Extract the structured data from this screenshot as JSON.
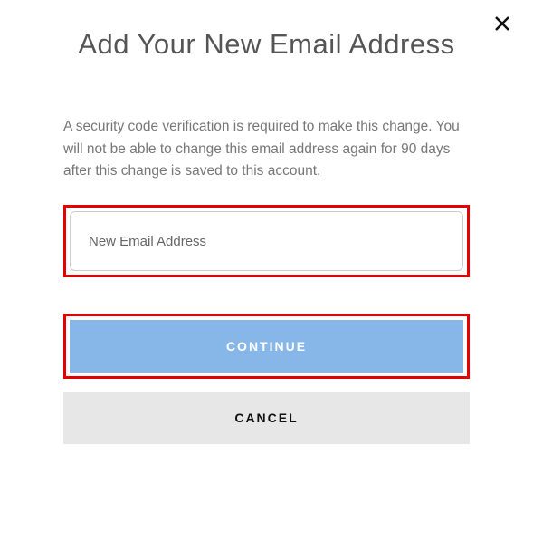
{
  "modal": {
    "title": "Add Your New Email Address",
    "description": "A security code verification is required to make this change. You will not be able to change this email address again for 90 days after this change is saved to this account.",
    "email_placeholder": "New Email Address",
    "continue_label": "CONTINUE",
    "cancel_label": "CANCEL"
  }
}
